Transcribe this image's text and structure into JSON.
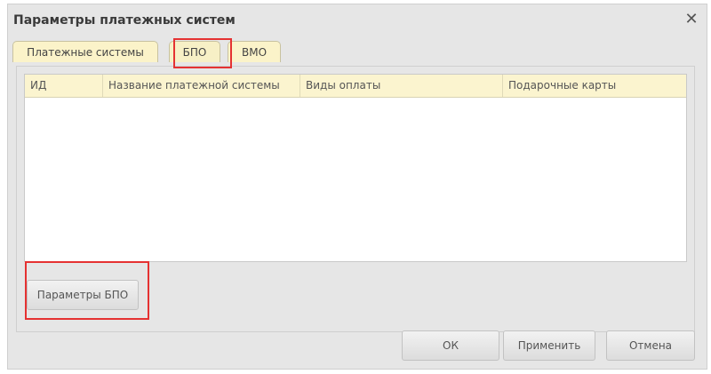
{
  "window": {
    "title": "Параметры платежных систем",
    "close_symbol": "✕"
  },
  "tabs": [
    {
      "label": "Платежные системы"
    },
    {
      "label": "БПО"
    },
    {
      "label": "ВМО"
    }
  ],
  "table": {
    "columns": [
      "ИД",
      "Название платежной системы",
      "Виды оплаты",
      "Подарочные карты"
    ],
    "rows": []
  },
  "buttons": {
    "bpo_params": "Параметры БПО",
    "ok": "ОК",
    "apply": "Применить",
    "cancel": "Отмена"
  },
  "colors": {
    "highlight": "#e53232",
    "tab_bg": "#fbf3c9",
    "header_bg": "#fbf4cf"
  }
}
